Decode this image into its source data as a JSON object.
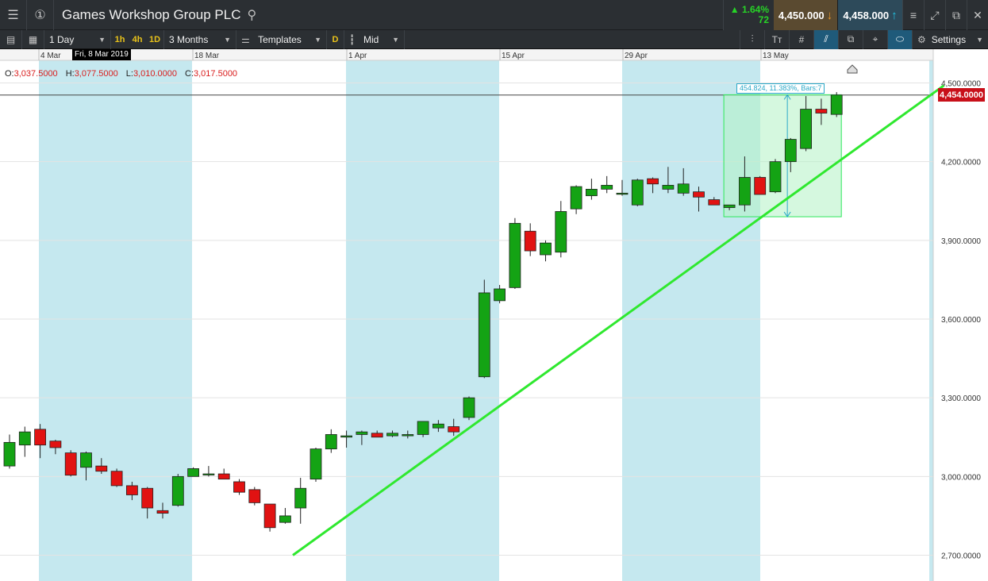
{
  "window": {
    "title": "Games Workshop Group PLC",
    "menu_icon": "hamburger-icon",
    "alert_icon": "info-circle-icon",
    "search_icon": "search-icon"
  },
  "quote": {
    "change_pct": "▲ 1.64%",
    "change_points": "72",
    "sell_price": "4,450.000",
    "buy_price": "4,458.000",
    "sell_arrow": "↓",
    "buy_arrow": "↑"
  },
  "toolbar": {
    "interval": "1 Day",
    "timeframes": [
      "1h",
      "4h",
      "1D"
    ],
    "range": "3 Months",
    "templates": "Templates",
    "d_button": "D",
    "price_type": "Mid",
    "settings": "Settings"
  },
  "chart": {
    "date_tooltip": "Fri, 8 Mar 2019",
    "ohlc": {
      "o_label": "O:",
      "o_value": "3,037.5000",
      "h_label": "H:",
      "h_value": "3,077.5000",
      "l_label": "L:",
      "l_value": "3,010.0000",
      "c_label": "C:",
      "c_value": "3,017.5000"
    },
    "current_price_tag": "4,454.0000",
    "measure_label": "454.824, 11.383%, Bars:7"
  },
  "chart_data": {
    "type": "candlestick",
    "x_tick_labels": [
      "4 Mar",
      "18 Mar",
      "1 Apr",
      "15 Apr",
      "29 Apr",
      "13 May"
    ],
    "y_tick_labels": [
      "4,500.0000",
      "4,200.0000",
      "3,900.0000",
      "3,600.0000",
      "3,300.0000",
      "3,000.0000",
      "2,700.0000"
    ],
    "ylim": [
      2700,
      4500
    ],
    "candles": [
      {
        "o": 3040,
        "h": 3160,
        "l": 3030,
        "c": 3130
      },
      {
        "o": 3120,
        "h": 3190,
        "l": 3075,
        "c": 3170
      },
      {
        "o": 3180,
        "h": 3200,
        "l": 3070,
        "c": 3120
      },
      {
        "o": 3135,
        "h": 3140,
        "l": 3085,
        "c": 3110
      },
      {
        "o": 3090,
        "h": 3100,
        "l": 3000,
        "c": 3005
      },
      {
        "o": 3035,
        "h": 3095,
        "l": 2985,
        "c": 3090
      },
      {
        "o": 3040,
        "h": 3070,
        "l": 3010,
        "c": 3020
      },
      {
        "o": 3020,
        "h": 3030,
        "l": 2960,
        "c": 2965
      },
      {
        "o": 2965,
        "h": 2980,
        "l": 2910,
        "c": 2930
      },
      {
        "o": 2955,
        "h": 2960,
        "l": 2840,
        "c": 2880
      },
      {
        "o": 2870,
        "h": 2900,
        "l": 2840,
        "c": 2860
      },
      {
        "o": 2890,
        "h": 3010,
        "l": 2885,
        "c": 3000
      },
      {
        "o": 3000,
        "h": 3035,
        "l": 3000,
        "c": 3030
      },
      {
        "o": 3010,
        "h": 3040,
        "l": 3000,
        "c": 3010
      },
      {
        "o": 3010,
        "h": 3030,
        "l": 2990,
        "c": 2990
      },
      {
        "o": 2980,
        "h": 2990,
        "l": 2930,
        "c": 2940
      },
      {
        "o": 2950,
        "h": 2960,
        "l": 2890,
        "c": 2900
      },
      {
        "o": 2895,
        "h": 2895,
        "l": 2790,
        "c": 2805
      },
      {
        "o": 2825,
        "h": 2880,
        "l": 2820,
        "c": 2850
      },
      {
        "o": 2880,
        "h": 2995,
        "l": 2820,
        "c": 2955
      },
      {
        "o": 2990,
        "h": 3110,
        "l": 2980,
        "c": 3105
      },
      {
        "o": 3105,
        "h": 3180,
        "l": 3090,
        "c": 3160
      },
      {
        "o": 3150,
        "h": 3175,
        "l": 3110,
        "c": 3155
      },
      {
        "o": 3160,
        "h": 3175,
        "l": 3120,
        "c": 3170
      },
      {
        "o": 3165,
        "h": 3175,
        "l": 3150,
        "c": 3150
      },
      {
        "o": 3155,
        "h": 3175,
        "l": 3150,
        "c": 3165
      },
      {
        "o": 3155,
        "h": 3175,
        "l": 3145,
        "c": 3160
      },
      {
        "o": 3160,
        "h": 3210,
        "l": 3150,
        "c": 3210
      },
      {
        "o": 3185,
        "h": 3215,
        "l": 3170,
        "c": 3200
      },
      {
        "o": 3190,
        "h": 3220,
        "l": 3155,
        "c": 3170
      },
      {
        "o": 3225,
        "h": 3305,
        "l": 3215,
        "c": 3300
      },
      {
        "o": 3380,
        "h": 3750,
        "l": 3375,
        "c": 3700
      },
      {
        "o": 3670,
        "h": 3730,
        "l": 3660,
        "c": 3715
      },
      {
        "o": 3720,
        "h": 3985,
        "l": 3715,
        "c": 3965
      },
      {
        "o": 3935,
        "h": 3965,
        "l": 3840,
        "c": 3860
      },
      {
        "o": 3845,
        "h": 3900,
        "l": 3820,
        "c": 3890
      },
      {
        "o": 3855,
        "h": 4050,
        "l": 3835,
        "c": 4010
      },
      {
        "o": 4020,
        "h": 4110,
        "l": 4000,
        "c": 4105
      },
      {
        "o": 4070,
        "h": 4135,
        "l": 4055,
        "c": 4095
      },
      {
        "o": 4095,
        "h": 4145,
        "l": 4080,
        "c": 4110
      },
      {
        "o": 4080,
        "h": 4130,
        "l": 4070,
        "c": 4080
      },
      {
        "o": 4035,
        "h": 4135,
        "l": 4030,
        "c": 4130
      },
      {
        "o": 4135,
        "h": 4140,
        "l": 4080,
        "c": 4115
      },
      {
        "o": 4095,
        "h": 4180,
        "l": 4080,
        "c": 4110
      },
      {
        "o": 4080,
        "h": 4175,
        "l": 4070,
        "c": 4115
      },
      {
        "o": 4085,
        "h": 4105,
        "l": 4010,
        "c": 4065
      },
      {
        "o": 4055,
        "h": 4065,
        "l": 4035,
        "c": 4035
      },
      {
        "o": 4025,
        "h": 4035,
        "l": 4015,
        "c": 4035
      },
      {
        "o": 4035,
        "h": 4220,
        "l": 4010,
        "c": 4140
      },
      {
        "o": 4140,
        "h": 4145,
        "l": 4075,
        "c": 4075
      },
      {
        "o": 4085,
        "h": 4210,
        "l": 4080,
        "c": 4200
      },
      {
        "o": 4200,
        "h": 4290,
        "l": 4160,
        "c": 4285
      },
      {
        "o": 4250,
        "h": 4450,
        "l": 4240,
        "c": 4400
      },
      {
        "o": 4400,
        "h": 4440,
        "l": 4340,
        "c": 4385
      },
      {
        "o": 4380,
        "h": 4465,
        "l": 4370,
        "c": 4454
      }
    ],
    "trendline": {
      "start_index": 18.5,
      "start_value": 2700,
      "end_index": 61,
      "end_value": 4490
    },
    "measure": {
      "start_index": 47,
      "end_index": 54,
      "low": 3990,
      "high": 4455
    },
    "colors": {
      "up": "#14a314",
      "down": "#e11212",
      "trend": "#2fe82f",
      "weekend_band": "#c5e8ef",
      "measure_fill": "#b3f2c4",
      "grid": "#e3e3e3"
    }
  }
}
